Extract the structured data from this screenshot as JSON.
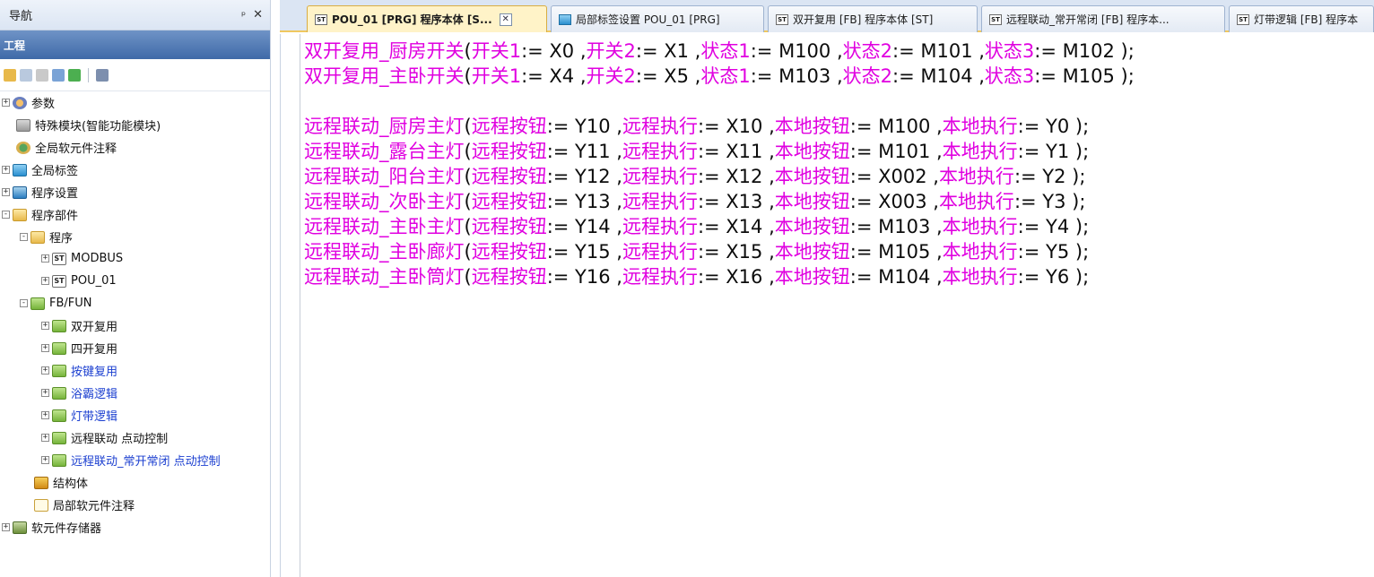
{
  "nav": {
    "title": "导航",
    "pin": "ᵖ",
    "close": "✕",
    "project_label": "工程"
  },
  "tree": [
    {
      "label": "参数",
      "icon": "gear-icon"
    },
    {
      "label": "特殊模块(智能功能模块)",
      "icon": "module-icon"
    },
    {
      "label": "全局软元件注释",
      "icon": "comment-icon"
    },
    {
      "label": "全局标签",
      "icon": "label-icon"
    },
    {
      "label": "程序设置",
      "icon": "settings-icon"
    },
    {
      "label": "程序部件",
      "icon": "parts-icon"
    },
    {
      "label": "程序",
      "icon": "folder-icon"
    },
    {
      "label": "MODBUS",
      "icon": "st-program-icon"
    },
    {
      "label": "POU_01",
      "icon": "st-program-icon"
    },
    {
      "label": "FB/FUN",
      "icon": "folder-icon"
    },
    {
      "label": "双开复用",
      "icon": "fb-folder-icon"
    },
    {
      "label": "四开复用",
      "icon": "fb-folder-icon"
    },
    {
      "label": "按键复用",
      "icon": "fb-folder-icon"
    },
    {
      "label": "浴霸逻辑",
      "icon": "fb-folder-icon"
    },
    {
      "label": "灯带逻辑",
      "icon": "fb-folder-icon"
    },
    {
      "label": "远程联动 点动控制",
      "icon": "fb-folder-icon"
    },
    {
      "label": "远程联动_常开常闭 点动控制",
      "icon": "fb-folder-icon"
    },
    {
      "label": "结构体",
      "icon": "struct-icon"
    },
    {
      "label": "局部软元件注释",
      "icon": "note-icon"
    },
    {
      "label": "软元件存储器",
      "icon": "memory-icon"
    }
  ],
  "tabs": [
    {
      "label": "POU_01 [PRG] 程序本体 [S...",
      "close": "✕"
    },
    {
      "label": "局部标签设置 POU_01 [PRG]"
    },
    {
      "label": "双开复用 [FB] 程序本体 [ST]"
    },
    {
      "label": "远程联动_常开常闭 [FB] 程序本..."
    },
    {
      "label": "灯带逻辑 [FB] 程序本"
    }
  ],
  "code": [
    [
      {
        "t": "双开复用_厨房开关",
        "k": 1
      },
      {
        "t": "(",
        "k": 0
      },
      {
        "t": "开关1",
        "k": 1
      },
      {
        "t": ":= X0 ,",
        "k": 0
      },
      {
        "t": "开关2",
        "k": 1
      },
      {
        "t": ":= X1 ,",
        "k": 0
      },
      {
        "t": "状态1",
        "k": 1
      },
      {
        "t": ":= M100 ,",
        "k": 0
      },
      {
        "t": "状态2",
        "k": 1
      },
      {
        "t": ":= M101 ,",
        "k": 0
      },
      {
        "t": "状态3",
        "k": 1
      },
      {
        "t": ":= M102 );",
        "k": 0
      }
    ],
    [
      {
        "t": "双开复用_主卧开关",
        "k": 1
      },
      {
        "t": "(",
        "k": 0
      },
      {
        "t": "开关1",
        "k": 1
      },
      {
        "t": ":= X4 ,",
        "k": 0
      },
      {
        "t": "开关2",
        "k": 1
      },
      {
        "t": ":= X5 ,",
        "k": 0
      },
      {
        "t": "状态1",
        "k": 1
      },
      {
        "t": ":= M103 ,",
        "k": 0
      },
      {
        "t": "状态2",
        "k": 1
      },
      {
        "t": ":= M104 ,",
        "k": 0
      },
      {
        "t": "状态3",
        "k": 1
      },
      {
        "t": ":= M105 );",
        "k": 0
      }
    ],
    [],
    [
      {
        "t": "远程联动_厨房主灯",
        "k": 1
      },
      {
        "t": "(",
        "k": 0
      },
      {
        "t": "远程按钮",
        "k": 1
      },
      {
        "t": ":= Y10 ,",
        "k": 0
      },
      {
        "t": "远程执行",
        "k": 1
      },
      {
        "t": ":= X10 ,",
        "k": 0
      },
      {
        "t": "本地按钮",
        "k": 1
      },
      {
        "t": ":= M100 ,",
        "k": 0
      },
      {
        "t": "本地执行",
        "k": 1
      },
      {
        "t": ":= Y0 );",
        "k": 0
      }
    ],
    [
      {
        "t": "远程联动_露台主灯",
        "k": 1
      },
      {
        "t": "(",
        "k": 0
      },
      {
        "t": "远程按钮",
        "k": 1
      },
      {
        "t": ":= Y11 ,",
        "k": 0
      },
      {
        "t": "远程执行",
        "k": 1
      },
      {
        "t": ":= X11 ,",
        "k": 0
      },
      {
        "t": "本地按钮",
        "k": 1
      },
      {
        "t": ":= M101 ,",
        "k": 0
      },
      {
        "t": "本地执行",
        "k": 1
      },
      {
        "t": ":= Y1 );",
        "k": 0
      }
    ],
    [
      {
        "t": "远程联动_阳台主灯",
        "k": 1
      },
      {
        "t": "(",
        "k": 0
      },
      {
        "t": "远程按钮",
        "k": 1
      },
      {
        "t": ":= Y12 ,",
        "k": 0
      },
      {
        "t": "远程执行",
        "k": 1
      },
      {
        "t": ":= X12 ,",
        "k": 0
      },
      {
        "t": "本地按钮",
        "k": 1
      },
      {
        "t": ":= X002 ,",
        "k": 0
      },
      {
        "t": "本地执行",
        "k": 1
      },
      {
        "t": ":= Y2 );",
        "k": 0
      }
    ],
    [
      {
        "t": "远程联动_次卧主灯",
        "k": 1
      },
      {
        "t": "(",
        "k": 0
      },
      {
        "t": "远程按钮",
        "k": 1
      },
      {
        "t": ":= Y13 ,",
        "k": 0
      },
      {
        "t": "远程执行",
        "k": 1
      },
      {
        "t": ":= X13 ,",
        "k": 0
      },
      {
        "t": "本地按钮",
        "k": 1
      },
      {
        "t": ":= X003 ,",
        "k": 0
      },
      {
        "t": "本地执行",
        "k": 1
      },
      {
        "t": ":= Y3 );",
        "k": 0
      }
    ],
    [
      {
        "t": "远程联动_主卧主灯",
        "k": 1
      },
      {
        "t": "(",
        "k": 0
      },
      {
        "t": "远程按钮",
        "k": 1
      },
      {
        "t": ":= Y14 ,",
        "k": 0
      },
      {
        "t": "远程执行",
        "k": 1
      },
      {
        "t": ":= X14 ,",
        "k": 0
      },
      {
        "t": "本地按钮",
        "k": 1
      },
      {
        "t": ":= M103 ,",
        "k": 0
      },
      {
        "t": "本地执行",
        "k": 1
      },
      {
        "t": ":= Y4 );",
        "k": 0
      }
    ],
    [
      {
        "t": "远程联动_主卧廊灯",
        "k": 1
      },
      {
        "t": "(",
        "k": 0
      },
      {
        "t": "远程按钮",
        "k": 1
      },
      {
        "t": ":= Y15 ,",
        "k": 0
      },
      {
        "t": "远程执行",
        "k": 1
      },
      {
        "t": ":= X15 ,",
        "k": 0
      },
      {
        "t": "本地按钮",
        "k": 1
      },
      {
        "t": ":= M105 ,",
        "k": 0
      },
      {
        "t": "本地执行",
        "k": 1
      },
      {
        "t": ":= Y5 );",
        "k": 0
      }
    ],
    [
      {
        "t": "远程联动_主卧筒灯",
        "k": 1
      },
      {
        "t": "(",
        "k": 0
      },
      {
        "t": "远程按钮",
        "k": 1
      },
      {
        "t": ":= Y16 ,",
        "k": 0
      },
      {
        "t": "远程执行",
        "k": 1
      },
      {
        "t": ":= X16 ,",
        "k": 0
      },
      {
        "t": "本地按钮",
        "k": 1
      },
      {
        "t": ":= M104 ,",
        "k": 0
      },
      {
        "t": "本地执行",
        "k": 1
      },
      {
        "t": ":= Y6 );",
        "k": 0
      }
    ]
  ],
  "colors": {
    "keyword": "#e000e0",
    "text": "#0c0c0c",
    "active_tab": "#fff3c8",
    "project_bar": "#3f6aa8",
    "link_blue": "#1b3fd0"
  }
}
